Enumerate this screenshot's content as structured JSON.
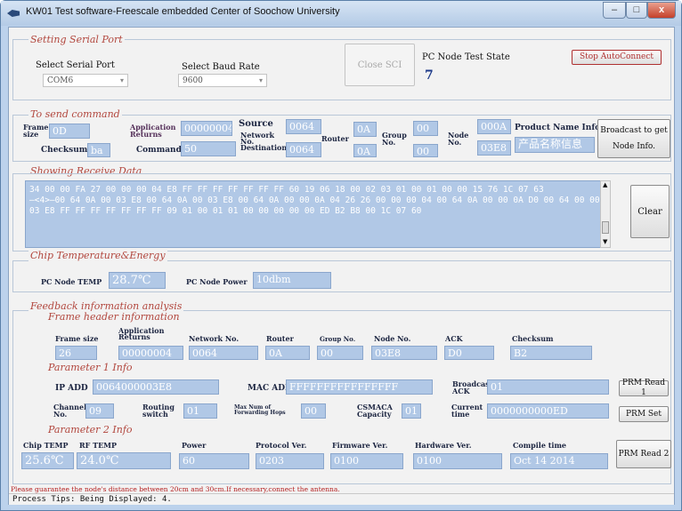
{
  "window": {
    "title": "KW01 Test software-Freescale embedded Center of Soochow University",
    "min": "–",
    "max": "□",
    "close": "x"
  },
  "serial": {
    "title": "Setting Serial Port",
    "port_label": "Select Serial Port",
    "port_value": "COM6",
    "baud_label": "Select Baud Rate",
    "baud_value": "9600",
    "close_sci": "Close SCI",
    "state_label": "PC Node Test State",
    "state_value": "7",
    "stop_btn": "Stop AutoConnect"
  },
  "send": {
    "title": "To send command",
    "frame_size_l": "Frame\nsize",
    "frame_size": "0D",
    "app_returns_l": "Application\nReturns",
    "app_returns": "00000004",
    "source_l": "Source",
    "source": "0064",
    "router_l": "Router",
    "router": "0A",
    "group_l": "Group\nNo.",
    "group": "00",
    "node_l": "Node\nNo.",
    "node": "000A",
    "product_l": "Product Name Info",
    "product": "产品名称信息",
    "checksum_l": "Checksum",
    "checksum": "ba",
    "command_l": "Command",
    "command": "50",
    "net_dest_l": "Network\nNo.\nDestination",
    "net_dest": "0064",
    "router2": "0A",
    "group2": "00",
    "node2": "03E8",
    "broadcast_btn": "Broadcast to get\nNode Info."
  },
  "receive": {
    "title": "Showing Receive Data",
    "text": "34 00 00 FA 27 00 00 00 04 E8 FF FF FF FF FF FF FF 60 19 06 18 00 02 03 01 00 01 00 00 15 76 1C 07 63\n—<4>—00 64 0A 00 03 E8 00 64 0A 00 03 E8 00 64 0A 00 00 0A 04 26 26 00 00 00 04 00 64 0A 00 00 0A D0 00 64 00 00 03 E8 FF FF FF FF FF FF FF 09 01 00 01 01 00 00 00 00 00 ED B2 B8 00 1C 07 60",
    "clear": "Clear"
  },
  "chip": {
    "title": "Chip Temperature&Energy",
    "temp_l": "PC Node TEMP",
    "temp": "28.7℃",
    "power_l": "PC Node Power",
    "power": "10dbm"
  },
  "feedback": {
    "title": "Feedback information analysis",
    "frame_title": "Frame header information",
    "frame_size_l": "Frame size",
    "frame_size": "26",
    "app_l": "Application\nReturns",
    "app": "00000004",
    "net_l": "Network No.",
    "net": "0064",
    "router_l": "Router",
    "router": "0A",
    "group_l": "Group No.",
    "group": "00",
    "node_l": "Node No.",
    "node": "03E8",
    "ack_l": "ACK",
    "ack": "D0",
    "checksum_l": "Checksum",
    "checksum": "B2"
  },
  "param1": {
    "title": "Parameter 1 Info",
    "ip_l": "IP ADD",
    "ip": "0064000003E8",
    "mac_l": "MAC ADD",
    "mac": "FFFFFFFFFFFFFFFF",
    "bcast_l": "Broadcast\nACK",
    "bcast": "01",
    "read_btn": "PRM Read 1",
    "channel_l": "Channel\nNo.",
    "channel": "09",
    "routing_l": "Routing\nswitch",
    "routing": "01",
    "hops_l": "Max Num of\nForwarding Hops",
    "hops": "00",
    "csmaca_l": "CSMACA\nCapacity",
    "csmaca": "01",
    "time_l": "Current\ntime",
    "time": "0000000000ED",
    "set_btn": "PRM Set"
  },
  "param2": {
    "title": "Parameter 2 Info",
    "chip_l": "Chip TEMP",
    "chip": "25.6℃",
    "rf_l": "RF TEMP",
    "rf": "24.0℃",
    "power_l": "Power",
    "power": "60",
    "proto_l": "Protocol Ver.",
    "proto": "0203",
    "fw_l": "Firmware Ver.",
    "fw": "0100",
    "hw_l": "Hardware Ver.",
    "hw": "0100",
    "compile_l": "Compile time",
    "compile": "Oct 14 2014",
    "read_btn": "PRM Read 2"
  },
  "notice": "Please guarantee the node's distance between 20cm and 30cm.If necessary,connect the antenna.",
  "status": "Process Tips: Being Displayed: 4."
}
